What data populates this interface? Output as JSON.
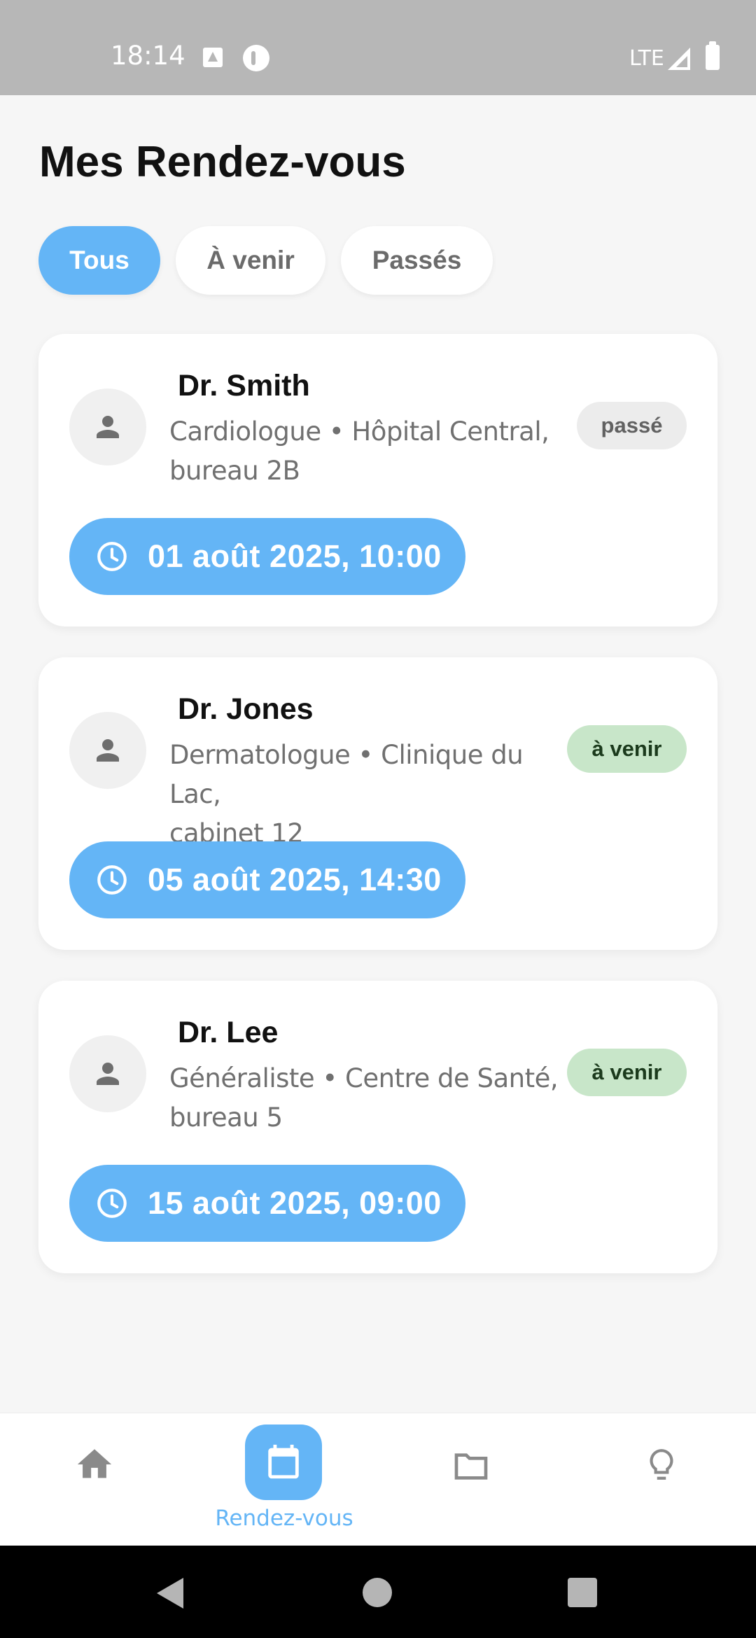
{
  "status_bar": {
    "time": "18:14",
    "network": "LTE"
  },
  "page": {
    "title": "Mes Rendez-vous"
  },
  "filters": [
    {
      "label": "Tous",
      "active": true
    },
    {
      "label": "À venir",
      "active": false
    },
    {
      "label": "Passés",
      "active": false
    }
  ],
  "appointments": [
    {
      "doctor": "Dr. Smith",
      "info_line1": "Cardiologue • Hôpital Central,",
      "info_line2": "bureau 2B",
      "status": "passé",
      "datetime": "01 août 2025, 10:00"
    },
    {
      "doctor": "Dr. Jones",
      "info_line1": "Dermatologue • Clinique du Lac,",
      "info_line2": "cabinet 12",
      "status": "à venir",
      "datetime": "05 août 2025, 14:30"
    },
    {
      "doctor": "Dr. Lee",
      "info_line1": "Généraliste • Centre de Santé,",
      "info_line2": "bureau 5",
      "status": "à venir",
      "datetime": "15 août 2025, 09:00"
    }
  ],
  "bottom_nav": {
    "items": [
      {
        "icon": "home-icon",
        "active": false
      },
      {
        "icon": "calendar-icon",
        "active": true,
        "label": "Rendez-vous"
      },
      {
        "icon": "folder-icon",
        "active": false
      },
      {
        "icon": "lightbulb-icon",
        "active": false
      }
    ]
  },
  "colors": {
    "accent": "#64b5f6",
    "upcoming_badge": "#c8e6c9",
    "past_badge": "#ececec",
    "background": "#f6f6f6"
  }
}
